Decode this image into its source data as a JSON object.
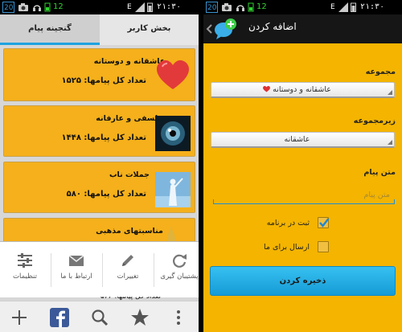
{
  "status_bar": {
    "badge": "20",
    "battery_level": "12",
    "clock": "۲۱:۳۰",
    "network": "E"
  },
  "left": {
    "tabs": [
      {
        "label": "بخش کاربر"
      },
      {
        "label": "گنجینه پیام"
      }
    ],
    "count_prefix": "تعداد کل پیامها:",
    "cards": [
      {
        "title": "عاشقانه و دوستانه",
        "count": "۱۵۲۵",
        "thumb_icon": "heart-icon"
      },
      {
        "title": "فلسفی و عارفانه",
        "count": "۱۴۴۸",
        "thumb_icon": "eye-photo"
      },
      {
        "title": "جملات ناب",
        "count": "۵۸۰",
        "thumb_icon": "statue-photo"
      },
      {
        "title": "مناسبتهای مذهبی",
        "count": "",
        "thumb_icon": "mosque-icon"
      }
    ],
    "partial_card_text": "تعداد کل پیامها: ۵۶۶",
    "menu": [
      {
        "label": "تنظیمات",
        "icon": "sliders-icon"
      },
      {
        "label": "ارتباط با ما",
        "icon": "mail-icon"
      },
      {
        "label": "تغییرات",
        "icon": "pencil-icon"
      },
      {
        "label": "پشتیبان گیری",
        "icon": "refresh-icon"
      }
    ],
    "bottom_bar": [
      "add-icon",
      "facebook-icon",
      "search-icon",
      "star-icon",
      "more-icon"
    ]
  },
  "right": {
    "title": "اضافه کردن",
    "group_label": "مجموعه",
    "group_value": "عاشقانه و دوستانه",
    "subgroup_label": "زیرمجموعه",
    "subgroup_value": "عاشقانه",
    "message_label": "متن پیام",
    "message_placeholder": "متن پیام",
    "message_value": "",
    "save_in_app_label": "ثبت در برنامه",
    "save_in_app_checked": true,
    "send_to_us_label": "ارسال برای ما",
    "send_to_us_checked": false,
    "save_button": "ذخیره کردن"
  },
  "colors": {
    "accent_blue": "#1ea3e0",
    "card_orange": "#f5b01b",
    "background_yellow": "#f4b400",
    "save_button_blue": "#169bd6"
  }
}
